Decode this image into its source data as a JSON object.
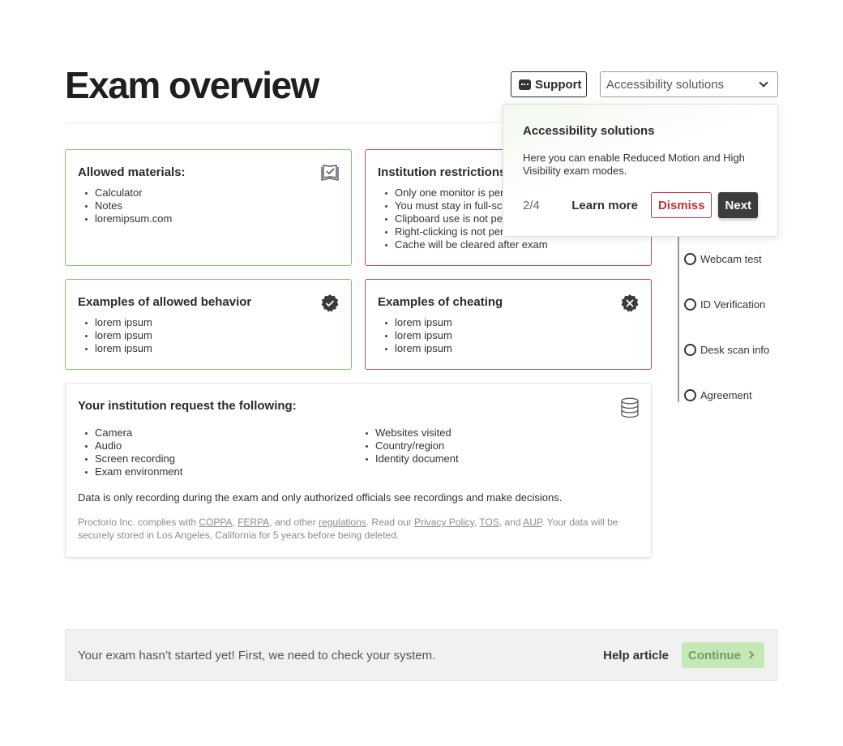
{
  "header": {
    "title": "Exam overview",
    "support_label": "Support",
    "accessibility_select_value": "Accessibility solutions"
  },
  "allowed_materials": {
    "heading": "Allowed materials:",
    "items": [
      "Calculator",
      "Notes",
      "loremipsum.com"
    ]
  },
  "institution_restrictions": {
    "heading": "Institution restrictions",
    "items": [
      "Only one monitor is permitted",
      "You must stay in full-screen",
      "Clipboard use is not permitted",
      "Right-clicking is not permitted",
      "Cache will be cleared after exam"
    ]
  },
  "allowed_behavior": {
    "heading": "Examples of allowed behavior",
    "items": [
      "lorem ipsum",
      "lorem ipsum",
      "lorem ipsum"
    ]
  },
  "cheating": {
    "heading": "Examples of cheating",
    "items": [
      "lorem ipsum",
      "lorem ipsum",
      "lorem ipsum"
    ]
  },
  "request": {
    "heading": "Your institution request the following:",
    "left_items": [
      "Camera",
      "Audio",
      "Screen recording",
      "Exam environment"
    ],
    "right_items": [
      "Websites visited",
      "Country/region",
      "Identity document"
    ],
    "note": "Data is only recording during the exam and only authorized officials see recordings and make decisions.",
    "legal": {
      "t1": "Proctorio Inc. complies with ",
      "coppa": "COPPA",
      "t2": ", ",
      "ferpa": "FERPA",
      "t3": ", and other ",
      "regulations": "regulations",
      "t4": ". Read our ",
      "privacy": "Privacy Policy",
      "t5": ", ",
      "tos": "TOS",
      "t6": ", and ",
      "aup": "AUP",
      "t7": ". Your data will be securely stored in Los Angeles, California for 5 years before being deleted."
    }
  },
  "steps": [
    "Webcam test",
    "ID Verification",
    "Desk scan info",
    "Agreement"
  ],
  "popover": {
    "title": "Accessibility solutions",
    "body": "Here you can enable Reduced Motion and High Visibility exam modes.",
    "step": "2/4",
    "learn_more": "Learn more",
    "dismiss": "Dismiss",
    "next": "Next"
  },
  "footer": {
    "message": "Your exam hasn’t started yet! First, we need to check your system.",
    "help": "Help article",
    "continue": "Continue"
  },
  "colors": {
    "allowed_border": "#7ec46b",
    "restricted_border": "#d0454e",
    "continue_bg": "#c4e8b6"
  }
}
